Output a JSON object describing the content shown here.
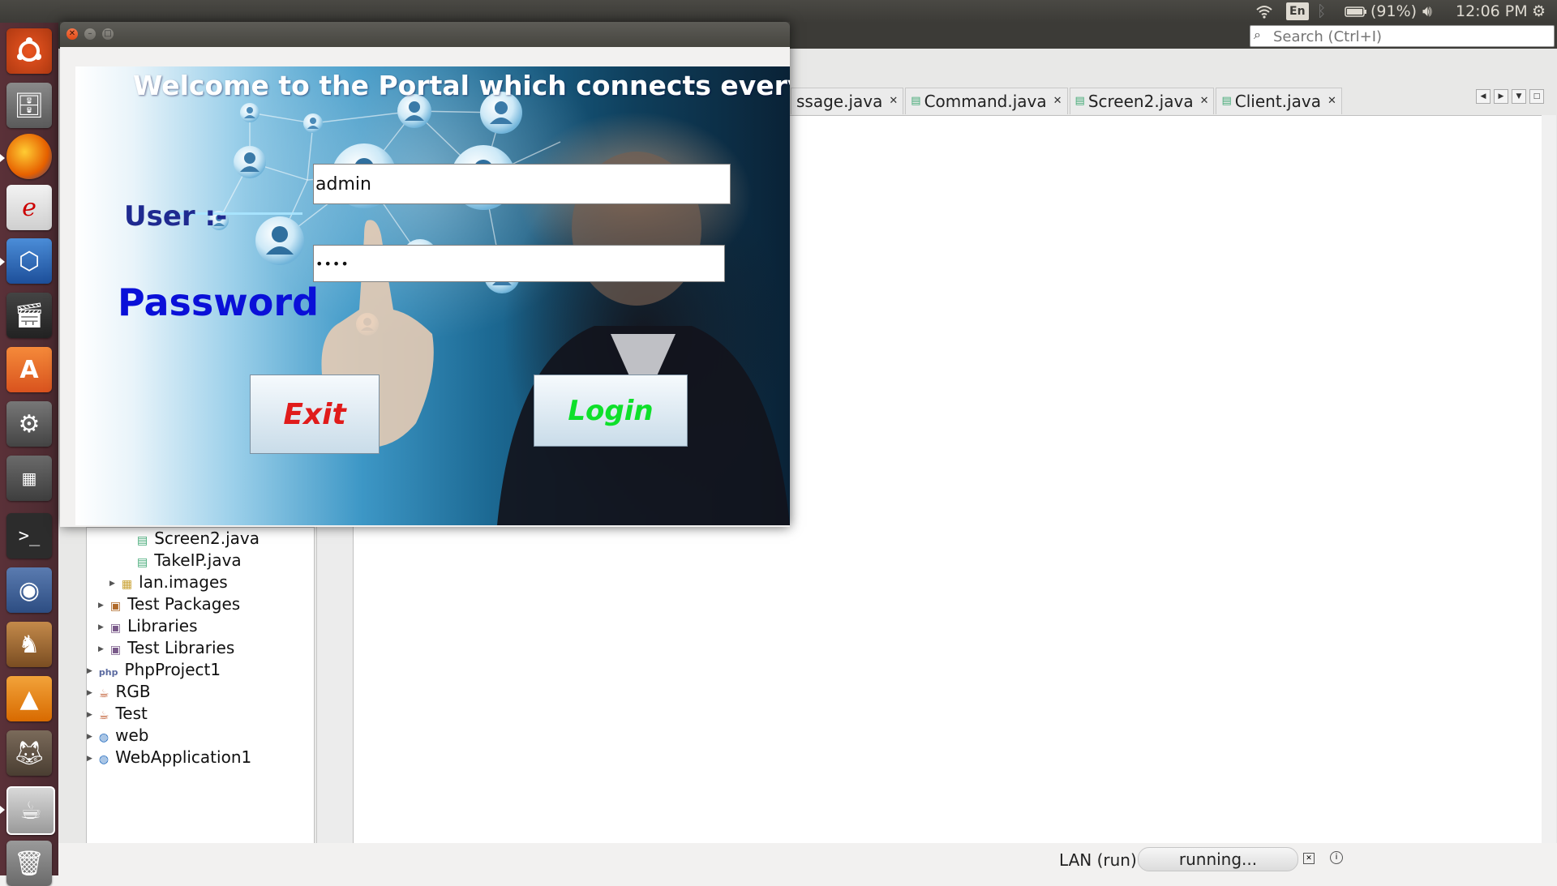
{
  "top_panel": {
    "keyboard_layout": "En",
    "battery": "(91%)",
    "time": "12:06 PM",
    "icons": [
      "wifi-icon",
      "bluetooth-icon",
      "battery-icon",
      "volume-icon",
      "settings-gear-icon"
    ]
  },
  "launcher": {
    "items": [
      "ubuntu-dash",
      "files",
      "firefox",
      "sketch",
      "virtualbox",
      "video-editor",
      "software-center",
      "system-settings",
      "workspace-switcher",
      "terminal",
      "blender",
      "chess",
      "vlc",
      "gimp",
      "netbeans",
      "trash"
    ]
  },
  "ide": {
    "search_placeholder": "Search (Ctrl+I)",
    "tabs": [
      {
        "label": "ssage.java"
      },
      {
        "label": "Command.java"
      },
      {
        "label": "Screen2.java"
      },
      {
        "label": "Client.java"
      }
    ],
    "tree": [
      {
        "label": "Screen2.java",
        "type": "java-file"
      },
      {
        "label": "TakeIP.java",
        "type": "java-file"
      },
      {
        "label": "lan.images",
        "type": "package"
      },
      {
        "label": "Test Packages",
        "type": "folder"
      },
      {
        "label": "Libraries",
        "type": "folder"
      },
      {
        "label": "Test Libraries",
        "type": "folder"
      },
      {
        "label": "PhpProject1",
        "type": "php-project"
      },
      {
        "label": "RGB",
        "type": "java-project"
      },
      {
        "label": "Test",
        "type": "java-project"
      },
      {
        "label": "web",
        "type": "web-project"
      },
      {
        "label": "WebApplication1",
        "type": "web-project"
      }
    ],
    "status_label": "LAN (run)",
    "status_progress": "running..."
  },
  "login": {
    "welcome": "Welcome to the Portal which connects everyon",
    "user_label": "User :-",
    "user_value": "admin",
    "password_label": "Password",
    "password_value": "••••",
    "exit_label": "Exit",
    "login_label": "Login",
    "colors": {
      "user_label": "#1f2a90",
      "password_label": "#0a10d8",
      "exit": "#e01b1b",
      "login": "#0ee02a"
    }
  }
}
